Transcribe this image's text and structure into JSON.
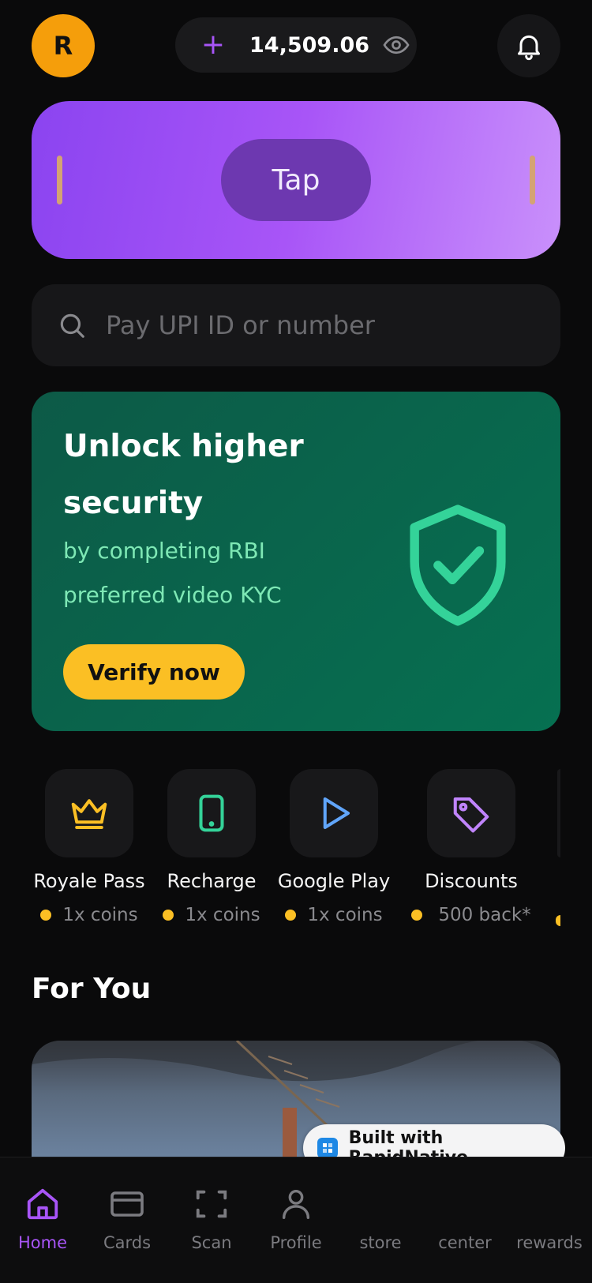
{
  "header": {
    "avatar_initial": "R",
    "balance": "14,509.06",
    "add_icon": "plus-icon",
    "visibility_icon": "eye-icon",
    "notification_icon": "bell-icon"
  },
  "tap_banner": {
    "button_label": "Tap"
  },
  "search": {
    "placeholder": "Pay UPI ID or number",
    "icon": "search-icon"
  },
  "kyc_card": {
    "title": "Unlock higher security",
    "subtitle": "by completing RBI preferred video KYC",
    "button_label": "Verify now",
    "icon": "shield-check-icon"
  },
  "quick_actions": [
    {
      "label": "Royale Pass",
      "sub": "1x coins",
      "icon": "crown-icon"
    },
    {
      "label": "Recharge",
      "sub": "1x coins",
      "icon": "phone-icon"
    },
    {
      "label": "Google Play",
      "sub": "1x coins",
      "icon": "play-icon"
    },
    {
      "label": "Discounts",
      "sub": "500 back*",
      "icon": "tag-icon"
    }
  ],
  "section_title": "For You",
  "badge": {
    "label": "Built with RapidNative"
  },
  "bottom_nav": {
    "active": "Home",
    "items": [
      {
        "label": "Home",
        "icon": "home-icon"
      },
      {
        "label": "Cards",
        "icon": "card-icon"
      },
      {
        "label": "Scan",
        "icon": "scan-icon"
      },
      {
        "label": "Profile",
        "icon": "user-icon"
      },
      {
        "label": "store",
        "icon": ""
      },
      {
        "label": "center",
        "icon": ""
      },
      {
        "label": "rewards",
        "icon": ""
      }
    ]
  },
  "colors": {
    "accent": "#a855f7",
    "kyc_green": "#34d399",
    "coin_yellow": "#fbbf24",
    "avatar_orange": "#f59e0b"
  }
}
